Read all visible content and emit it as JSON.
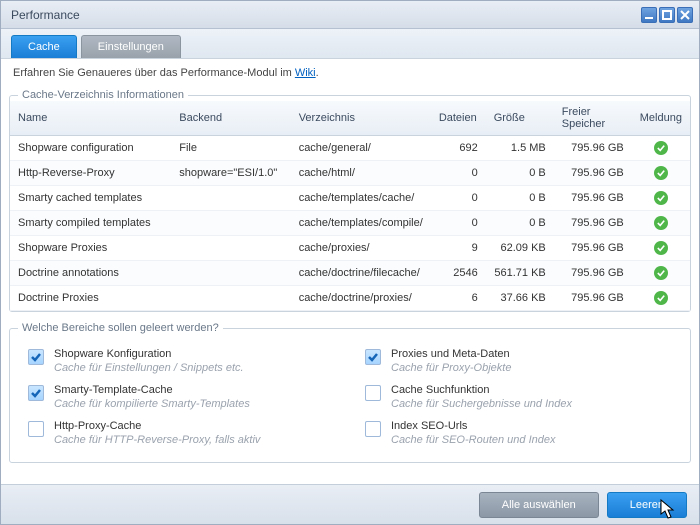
{
  "window": {
    "title": "Performance"
  },
  "tabs": {
    "cache": "Cache",
    "settings": "Einstellungen"
  },
  "info": {
    "prefix": "Erfahren Sie Genaueres über das Performance-Modul im ",
    "link": "Wiki",
    "suffix": "."
  },
  "section1": {
    "title": "Cache-Verzeichnis Informationen",
    "headers": {
      "name": "Name",
      "backend": "Backend",
      "dir": "Verzeichnis",
      "files": "Dateien",
      "size": "Größe",
      "free": "Freier Speicher",
      "msg": "Meldung"
    },
    "rows": [
      {
        "name": "Shopware configuration",
        "backend": "File",
        "dir": "cache/general/",
        "files": "692",
        "size": "1.5 MB",
        "free": "795.96 GB"
      },
      {
        "name": "Http-Reverse-Proxy",
        "backend": "shopware=\"ESI/1.0\"",
        "dir": "cache/html/",
        "files": "0",
        "size": "0 B",
        "free": "795.96 GB"
      },
      {
        "name": "Smarty cached templates",
        "backend": "",
        "dir": "cache/templates/cache/",
        "files": "0",
        "size": "0 B",
        "free": "795.96 GB"
      },
      {
        "name": "Smarty compiled templates",
        "backend": "",
        "dir": "cache/templates/compile/",
        "files": "0",
        "size": "0 B",
        "free": "795.96 GB"
      },
      {
        "name": "Shopware Proxies",
        "backend": "",
        "dir": "cache/proxies/",
        "files": "9",
        "size": "62.09 KB",
        "free": "795.96 GB"
      },
      {
        "name": "Doctrine annotations",
        "backend": "",
        "dir": "cache/doctrine/filecache/",
        "files": "2546",
        "size": "561.71 KB",
        "free": "795.96 GB"
      },
      {
        "name": "Doctrine Proxies",
        "backend": "",
        "dir": "cache/doctrine/proxies/",
        "files": "6",
        "size": "37.66 KB",
        "free": "795.96 GB"
      }
    ]
  },
  "section2": {
    "title": "Welche Bereiche sollen geleert werden?",
    "items": [
      {
        "label": "Shopware Konfiguration",
        "desc": "Cache für Einstellungen / Snippets etc.",
        "checked": true
      },
      {
        "label": "Proxies und Meta-Daten",
        "desc": "Cache für Proxy-Objekte",
        "checked": true
      },
      {
        "label": "Smarty-Template-Cache",
        "desc": "Cache für kompilierte Smarty-Templates",
        "checked": true
      },
      {
        "label": "Cache Suchfunktion",
        "desc": "Cache für Suchergebnisse und Index",
        "checked": false
      },
      {
        "label": "Http-Proxy-Cache",
        "desc": "Cache für HTTP-Reverse-Proxy, falls aktiv",
        "checked": false
      },
      {
        "label": "Index SEO-Urls",
        "desc": "Cache für SEO-Routen und Index",
        "checked": false
      }
    ]
  },
  "footer": {
    "selectAll": "Alle auswählen",
    "clear": "Leeren"
  }
}
